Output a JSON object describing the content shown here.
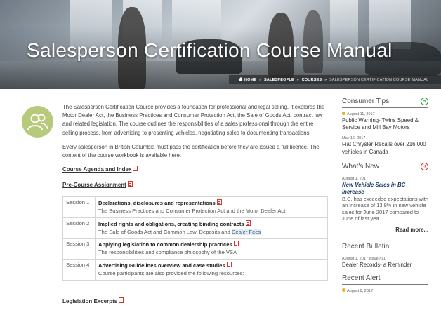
{
  "banner": {
    "title": "Salesperson Certification Course Manual"
  },
  "breadcrumb": {
    "items": [
      "HOME",
      "SALESPEOPLE",
      "COURSES"
    ],
    "current": "SALESPERSON CERTIFICATION COURSE MANUAL",
    "separator": "»"
  },
  "main": {
    "intro": "The Salesperson Certification Course provides a foundation for professional and legal selling. It explores the Motor Dealer Act, the Business Practices and Consumer Protection Act, the Sale of Goods Act, contract law and related legislation. The course outlines the responsibilities of a sales professional through the entire selling process, from advertising to presenting vehicles, negotiating sales to documenting transactions.",
    "requirement": "Every salesperson in British Columbia must pass the certification before they are issued a full licence. The content of the course workbook is available here:",
    "links": {
      "agenda": "Course Agenda and Index",
      "pre_course": "Pre-Course Assignment",
      "legislation": "Legislation Excerpts"
    },
    "sessions": [
      {
        "num": "Session 1",
        "title": "Declarations, disclosures and representations",
        "desc": "The Business Practices and Consumer Protection Act and the Motor Dealer Act"
      },
      {
        "num": "Session 2",
        "title": "Implied rights and obligations, creating binding contracts",
        "desc": "The Sale of Goods Act and Common Law, Deposits and ",
        "desc_highlight": "Dealer Fees"
      },
      {
        "num": "Session 3",
        "title": "Applying legislation to common dealership practices",
        "desc": "The responsibilities and compliance philosophy of the VSA"
      },
      {
        "num": "Session 4",
        "title": "Advertising Guidelines overview and case studies",
        "desc": "Course participants are also provided the following resources:"
      }
    ]
  },
  "sidebar": {
    "consumer_tips": {
      "heading": "Consumer Tips",
      "items": [
        {
          "date": "August 11, 2017",
          "title": "Public Warning- Twins Speed & Service and Mill Bay Motors"
        },
        {
          "date": "May 16, 2017",
          "title": "Fiat Chrysler Recalls over 216,000 vehicles in Canada"
        }
      ]
    },
    "whats_new": {
      "heading": "What's New",
      "date": "August 1, 2017",
      "title": "New Vehicle Sales in BC Increase",
      "body": "B.C. has exceeded expectations with an increase of 13.8% in new vehicle sales for June 2017 compared to June of last yea ...",
      "read_more": "Read more..."
    },
    "recent_bulletin": {
      "heading": "Recent Bulletin",
      "date": "August 1, 2017 Issue #11",
      "title": "Dealer Records- a Reminder"
    },
    "recent_alert": {
      "heading": "Recent Alert",
      "date": "August 8, 2017"
    }
  },
  "colors": {
    "avatar_bg": "#b7ca7c",
    "pdf_red": "#d9352c",
    "tips_green": "#2aa346",
    "alert_yellow": "#e9b21b",
    "news_title_blue": "#1c3a66"
  }
}
